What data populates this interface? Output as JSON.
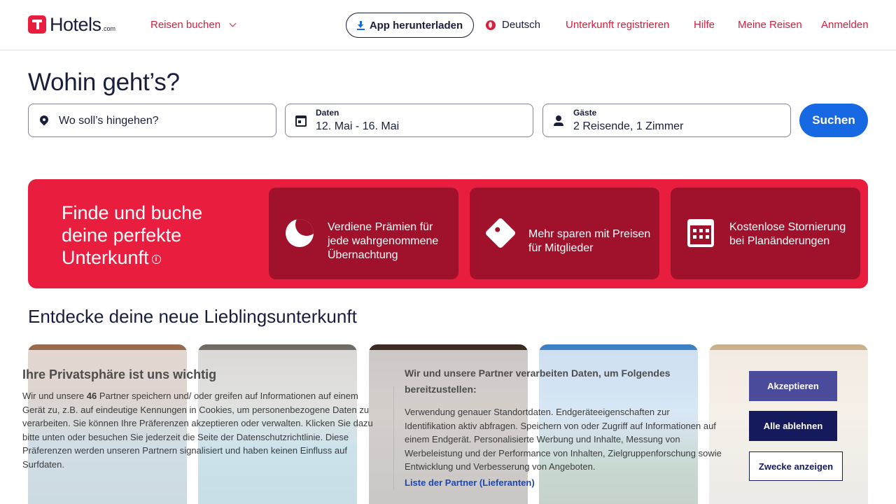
{
  "header": {
    "logo_text": "Hotels",
    "logo_suffix": ".com",
    "book_menu": "Reisen buchen",
    "app_button": "App herunterladen",
    "language": "Deutsch",
    "register_property": "Unterkunft registrieren",
    "help": "Hilfe",
    "my_trips": "Meine Reisen",
    "sign_in": "Anmelden"
  },
  "search": {
    "title": "Wohin geht’s?",
    "destination_placeholder": "Wo soll’s hingehen?",
    "dates_label": "Daten",
    "dates_value": "12. Mai - 16. Mai",
    "guests_label": "Gäste",
    "guests_value": "2 Reisende, 1 Zimmer",
    "search_button": "Suchen"
  },
  "promo": {
    "title": "Finde und buche deine perfekte Unterkunft",
    "info_glyph": "i",
    "cards": [
      {
        "icon": "moon-icon",
        "text": "Verdiene Prämien für jede wahrgenommene Übernachtung"
      },
      {
        "icon": "tag-icon",
        "text": "Mehr sparen mit Preisen für Mitglieder"
      },
      {
        "icon": "calendar-icon",
        "text": "Kostenlose Stornierung bei Planänderungen"
      }
    ]
  },
  "discover": {
    "title": "Entdecke deine neue Lieblingsunterkunft"
  },
  "cookie": {
    "title": "Ihre Privatsphäre ist uns wichtig",
    "body_prefix": "Wir und unsere ",
    "partner_count": "46",
    "body_suffix": " Partner speichern und/ oder greifen auf Informationen auf einem Gerät zu, z.B. auf eindeutige Kennungen in Cookies, um personenbezogene Daten zu verarbeiten. Sie können Ihre Präferenzen akzeptieren oder verwalten. Klicken Sie dazu bitte unten oder besuchen Sie jederzeit die Seite der Datenschutzrichtlinie. Diese Präferenzen werden unseren Partnern signalisiert und haben keinen Einfluss auf Surfdaten.",
    "purposes_heading": "Wir und unsere Partner verarbeiten Daten, um Folgendes bereitzustellen:",
    "purposes_text": "Verwendung genauer Standortdaten. Endgeräteeigenschaften zur Identifikation aktiv abfragen. Speichern von oder Zugriff auf Informationen auf einem Endgerät. Personalisierte Werbung und Inhalte, Messung von Werbeleistung und der Performance von Inhalten, Zielgruppenforschung sowie Entwicklung und Verbesserung von Angeboten.",
    "partners_link": "Liste der Partner (Lieferanten)",
    "accept_button": "Akzeptieren",
    "reject_button": "Alle ablehnen",
    "purposes_button": "Zwecke anzeigen"
  },
  "colors": {
    "brand_red": "#e91e3f",
    "card_red": "#a0122b",
    "link_red": "#d3203e",
    "primary_blue": "#1668e3",
    "navy": "#191e3b"
  }
}
